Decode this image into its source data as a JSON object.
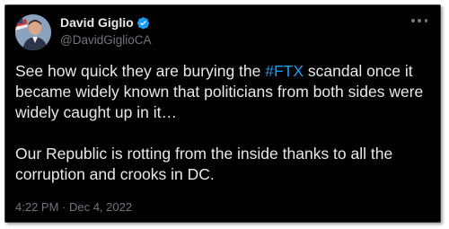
{
  "author": {
    "display_name": "David Giglio",
    "handle": "@DavidGiglioCA",
    "verified": true,
    "avatar_icon": "profile-photo",
    "verified_color": "#1d9bf0"
  },
  "tweet": {
    "p1_before": "See how quick they are burying the ",
    "hashtag": "#FTX",
    "p1_after": " scandal once it became widely known that politicians from both sides were widely caught up in it…",
    "p2": "Our Republic is rotting from the inside thanks to all the corruption and crooks in DC.",
    "timestamp": "4:22 PM · Dec 4, 2022"
  },
  "colors": {
    "background": "#000000",
    "text": "#e7e9ea",
    "muted": "#71767b",
    "link": "#1d9bf0"
  }
}
